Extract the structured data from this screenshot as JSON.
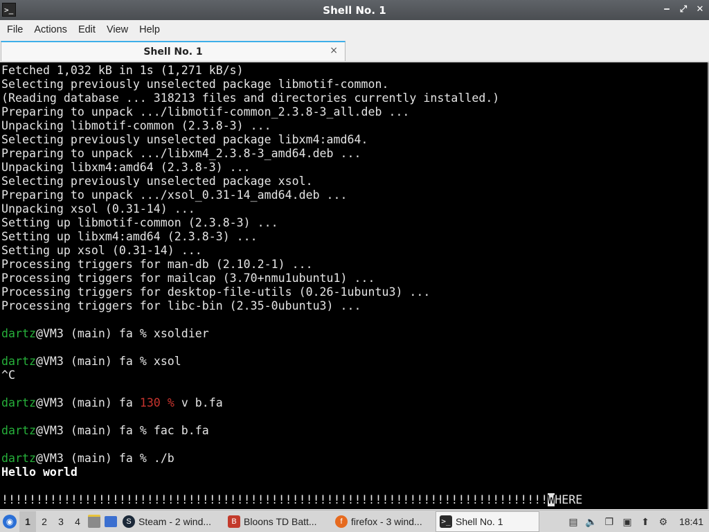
{
  "window": {
    "title": "Shell No. 1",
    "controls": {
      "minimize": "‒",
      "restore": "⤢",
      "close": "✕"
    }
  },
  "menu": [
    "File",
    "Actions",
    "Edit",
    "View",
    "Help"
  ],
  "tab": {
    "label": "Shell No. 1",
    "close": "×"
  },
  "terminal": {
    "output_lines": [
      "Fetched 1,032 kB in 1s (1,271 kB/s)",
      "Selecting previously unselected package libmotif-common.",
      "(Reading database ... 318213 files and directories currently installed.)",
      "Preparing to unpack .../libmotif-common_2.3.8-3_all.deb ...",
      "Unpacking libmotif-common (2.3.8-3) ...",
      "Selecting previously unselected package libxm4:amd64.",
      "Preparing to unpack .../libxm4_2.3.8-3_amd64.deb ...",
      "Unpacking libxm4:amd64 (2.3.8-3) ...",
      "Selecting previously unselected package xsol.",
      "Preparing to unpack .../xsol_0.31-14_amd64.deb ...",
      "Unpacking xsol (0.31-14) ...",
      "Setting up libmotif-common (2.3.8-3) ...",
      "Setting up libxm4:amd64 (2.3.8-3) ...",
      "Setting up xsol (0.31-14) ...",
      "Processing triggers for man-db (2.10.2-1) ...",
      "Processing triggers for mailcap (3.70+nmu1ubuntu1) ...",
      "Processing triggers for desktop-file-utils (0.26-1ubuntu3) ...",
      "Processing triggers for libc-bin (2.35-0ubuntu3) ..."
    ],
    "prompt_user": "dartz",
    "prompt_host": "@VM3 (main) fa",
    "prompt_symbol": "%",
    "prompt_error_code": "130",
    "commands": {
      "cmd1": "xsoldier",
      "cmd2": "xsol",
      "interrupt": "^C",
      "cmd3": "v b.fa",
      "cmd4": "fac b.fa",
      "cmd5": "./b"
    },
    "program_output": "Hello world",
    "last_line_bangs": "!!!!!!!!!!!!!!!!!!!!!!!!!!!!!!!!!!!!!!!!!!!!!!!!!!!!!!!!!!!!!!!!!!!!!!!!!!!!!!!",
    "last_line_cursor_char": "W",
    "last_line_rest": "HERE"
  },
  "taskbar": {
    "workspaces": [
      "1",
      "2",
      "3",
      "4"
    ],
    "tasks": [
      {
        "label": "Steam - 2 wind...",
        "icon": "steam-icon"
      },
      {
        "label": "Bloons TD Batt...",
        "icon": "bloons-icon"
      },
      {
        "label": "firefox - 3 wind...",
        "icon": "firefox-icon"
      },
      {
        "label": "Shell No. 1",
        "icon": "terminal-icon"
      }
    ],
    "clock": "18:41"
  },
  "colors": {
    "prompt_green": "#26b03a",
    "error_red": "#c8342e",
    "terminal_bg": "#000000",
    "tab_accent": "#3daee9"
  }
}
